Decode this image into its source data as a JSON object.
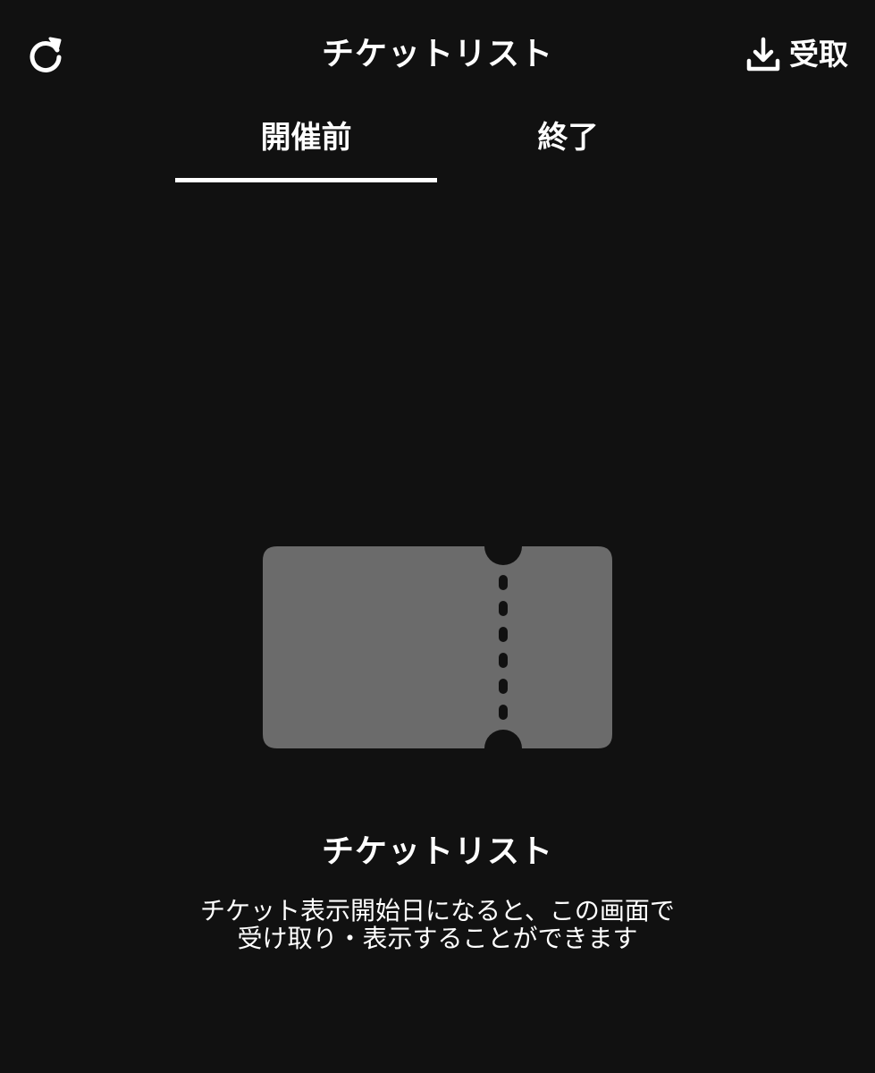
{
  "header": {
    "title": "チケットリスト",
    "refresh_icon": "refresh-icon",
    "receive_icon": "download-icon",
    "receive_label": "受取"
  },
  "tabs": [
    {
      "label": "開催前",
      "selected": true
    },
    {
      "label": "終了",
      "selected": false
    }
  ],
  "empty_state": {
    "illustration_icon": "ticket-icon",
    "title": "チケットリスト",
    "description_line1": "チケット表示開始日になると、この画面で",
    "description_line2": "受け取り・表示することができます"
  },
  "colors": {
    "background": "#111111",
    "text": "#ffffff",
    "ticket": "#6b6b6b",
    "tab_indicator": "#ffffff"
  }
}
